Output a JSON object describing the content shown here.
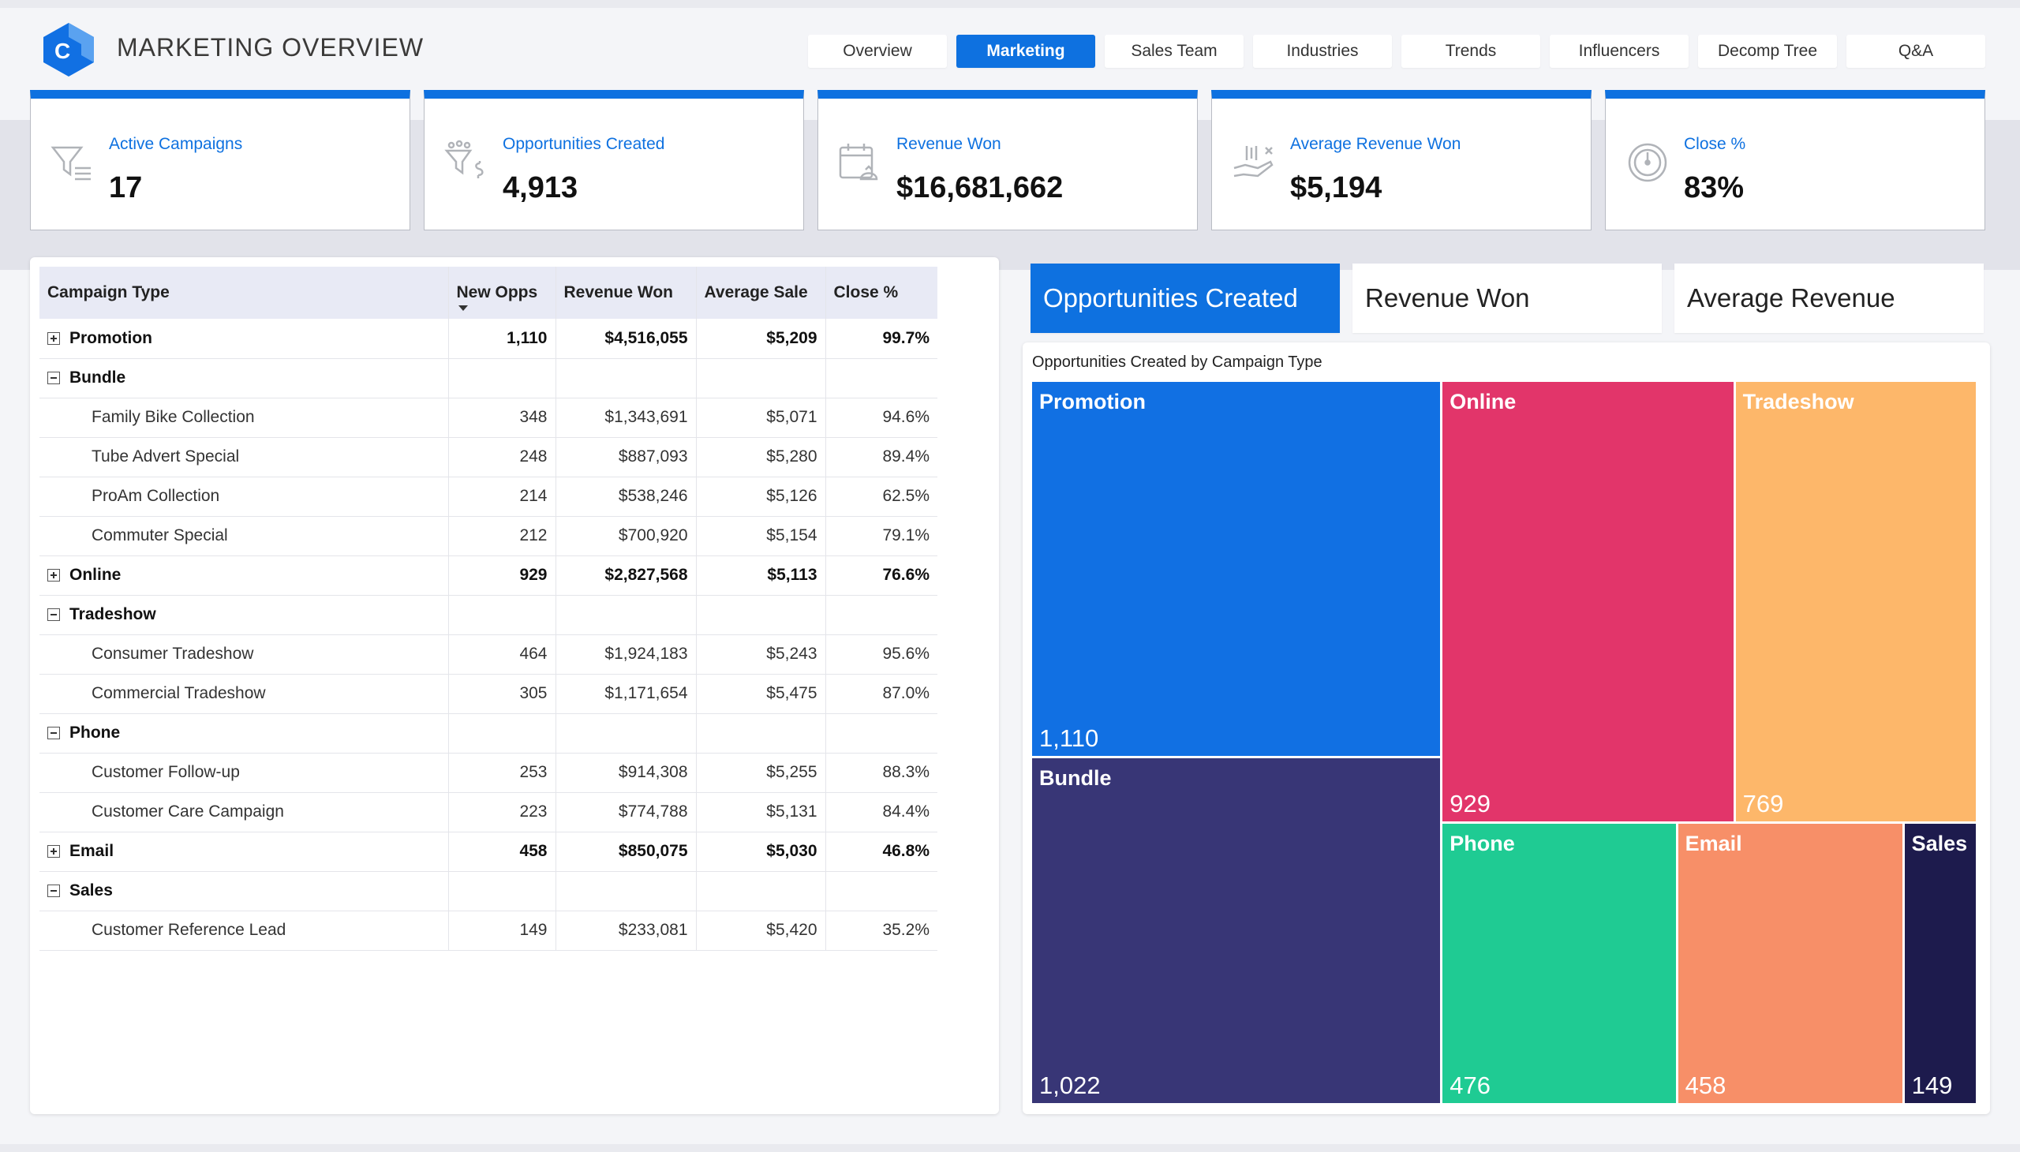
{
  "header": {
    "title": "MARKETING OVERVIEW",
    "logo_letter": "C",
    "nav": [
      {
        "label": "Overview",
        "active": false
      },
      {
        "label": "Marketing",
        "active": true
      },
      {
        "label": "Sales Team",
        "active": false
      },
      {
        "label": "Industries",
        "active": false
      },
      {
        "label": "Trends",
        "active": false
      },
      {
        "label": "Influencers",
        "active": false
      },
      {
        "label": "Decomp Tree",
        "active": false
      },
      {
        "label": "Q&A",
        "active": false
      }
    ]
  },
  "kpis": [
    {
      "label": "Active Campaigns",
      "value": "17",
      "icon": "filter-icon"
    },
    {
      "label": "Opportunities Created",
      "value": "4,913",
      "icon": "funnel-dollar-icon"
    },
    {
      "label": "Revenue Won",
      "value": "$16,681,662",
      "icon": "calendar-money-icon"
    },
    {
      "label": "Average Revenue Won",
      "value": "$5,194",
      "icon": "hand-money-icon"
    },
    {
      "label": "Close %",
      "value": "83%",
      "icon": "gauge-icon"
    }
  ],
  "matrix": {
    "columns": [
      "Campaign Type",
      "New Opps",
      "Revenue Won",
      "Average Sale",
      "Close %"
    ],
    "sorted_column": "New Opps",
    "rows": [
      {
        "level": 0,
        "toggle": "plus",
        "name": "Promotion",
        "opps": "1,110",
        "revenue": "$4,516,055",
        "avg": "$5,209",
        "close": "99.7%"
      },
      {
        "level": 0,
        "toggle": "minus",
        "name": "Bundle",
        "opps": "",
        "revenue": "",
        "avg": "",
        "close": ""
      },
      {
        "level": 1,
        "name": "Family Bike Collection",
        "opps": "348",
        "revenue": "$1,343,691",
        "avg": "$5,071",
        "close": "94.6%"
      },
      {
        "level": 1,
        "name": "Tube Advert Special",
        "opps": "248",
        "revenue": "$887,093",
        "avg": "$5,280",
        "close": "89.4%"
      },
      {
        "level": 1,
        "name": "ProAm Collection",
        "opps": "214",
        "revenue": "$538,246",
        "avg": "$5,126",
        "close": "62.5%"
      },
      {
        "level": 1,
        "name": "Commuter Special",
        "opps": "212",
        "revenue": "$700,920",
        "avg": "$5,154",
        "close": "79.1%"
      },
      {
        "level": 0,
        "toggle": "plus",
        "name": "Online",
        "opps": "929",
        "revenue": "$2,827,568",
        "avg": "$5,113",
        "close": "76.6%"
      },
      {
        "level": 0,
        "toggle": "minus",
        "name": "Tradeshow",
        "opps": "",
        "revenue": "",
        "avg": "",
        "close": ""
      },
      {
        "level": 1,
        "name": "Consumer Tradeshow",
        "opps": "464",
        "revenue": "$1,924,183",
        "avg": "$5,243",
        "close": "95.6%"
      },
      {
        "level": 1,
        "name": "Commercial Tradeshow",
        "opps": "305",
        "revenue": "$1,171,654",
        "avg": "$5,475",
        "close": "87.0%"
      },
      {
        "level": 0,
        "toggle": "minus",
        "name": "Phone",
        "opps": "",
        "revenue": "",
        "avg": "",
        "close": ""
      },
      {
        "level": 1,
        "name": "Customer Follow-up",
        "opps": "253",
        "revenue": "$914,308",
        "avg": "$5,255",
        "close": "88.3%"
      },
      {
        "level": 1,
        "name": "Customer Care Campaign",
        "opps": "223",
        "revenue": "$774,788",
        "avg": "$5,131",
        "close": "84.4%"
      },
      {
        "level": 0,
        "toggle": "plus",
        "name": "Email",
        "opps": "458",
        "revenue": "$850,075",
        "avg": "$5,030",
        "close": "46.8%"
      },
      {
        "level": 0,
        "toggle": "minus",
        "name": "Sales",
        "opps": "",
        "revenue": "",
        "avg": "",
        "close": ""
      },
      {
        "level": 1,
        "name": "Customer Reference Lead",
        "opps": "149",
        "revenue": "$233,081",
        "avg": "$5,420",
        "close": "35.2%"
      }
    ]
  },
  "tabs": [
    {
      "label": "Opportunities Created",
      "active": true
    },
    {
      "label": "Revenue Won",
      "active": false
    },
    {
      "label": "Average Revenue",
      "active": false
    }
  ],
  "treemap": {
    "title": "Opportunities Created by Campaign Type"
  },
  "chart_data": {
    "type": "treemap",
    "title": "Opportunities Created by Campaign Type",
    "categories": [
      "Promotion",
      "Bundle",
      "Online",
      "Tradeshow",
      "Phone",
      "Email",
      "Sales"
    ],
    "values": [
      1110,
      1022,
      929,
      769,
      476,
      458,
      149
    ],
    "labels": [
      "1,110",
      "1,022",
      "929",
      "769",
      "476",
      "458",
      "149"
    ],
    "colors": [
      "#1170e3",
      "#383676",
      "#e2356a",
      "#fdb76a",
      "#1fcb93",
      "#f78f68",
      "#1d1b4d"
    ]
  }
}
